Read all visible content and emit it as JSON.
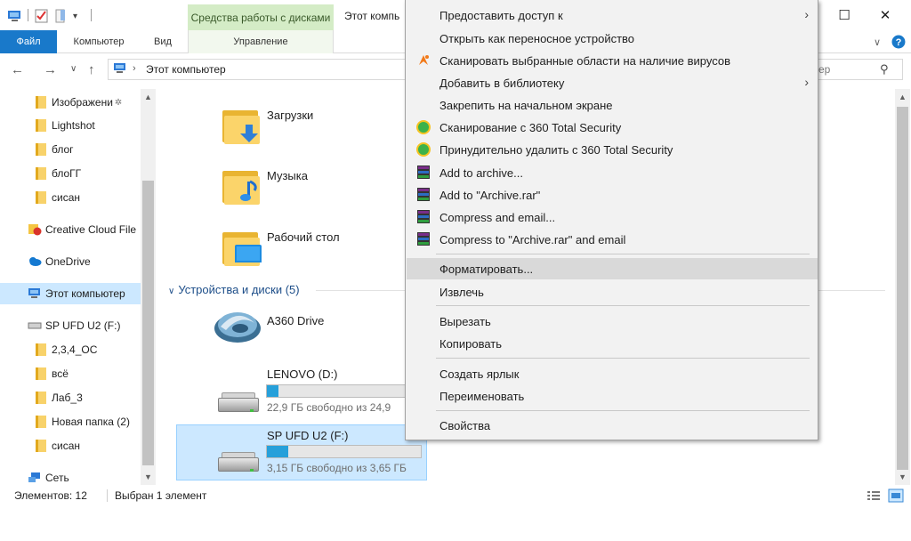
{
  "window": {
    "title": "Этот компь",
    "tools_tab": "Средства работы с дисками",
    "minimize": "—",
    "maximize": "☐",
    "close": "✕"
  },
  "ribbon": {
    "tabs": [
      "Файл",
      "Компьютер",
      "Вид",
      "Управление"
    ]
  },
  "address": {
    "path": "Этот компьютер",
    "search_placeholder": "ер"
  },
  "nav": {
    "items": [
      {
        "label": "Изображени",
        "pinned": true
      },
      {
        "label": "Lightshot"
      },
      {
        "label": "блог"
      },
      {
        "label": "блоГГ"
      },
      {
        "label": "сисан"
      },
      {
        "label": "Creative Cloud File"
      },
      {
        "label": "OneDrive"
      },
      {
        "label": "Этот компьютер",
        "selected": true
      },
      {
        "label": "SP UFD U2 (F:)"
      },
      {
        "label": "2,3,4_OC"
      },
      {
        "label": "всё"
      },
      {
        "label": "Лаб_3"
      },
      {
        "label": "Новая папка (2)"
      },
      {
        "label": "сисан"
      },
      {
        "label": "Сеть"
      }
    ]
  },
  "content": {
    "folders": [
      {
        "label": "Загрузки",
        "icon": "download-arrow"
      },
      {
        "label": "Музыка",
        "icon": "music-note"
      },
      {
        "label": "Рабочий стол",
        "icon": "desktop"
      }
    ],
    "group_header": "Устройства и диски (5)",
    "a360": {
      "label": "A360 Drive"
    },
    "drives": [
      {
        "label": "LENOVO (D:)",
        "free": "22,9 ГБ свободно из 24,9",
        "used_fraction": 0.08
      },
      {
        "label": "SP UFD U2 (F:)",
        "free": "3,15 ГБ свободно из 3,65 ГБ",
        "used_fraction": 0.14,
        "selected": true
      }
    ]
  },
  "status": {
    "count": "Элементов: 12",
    "selected": "Выбран 1 элемент"
  },
  "context_menu": {
    "items": [
      {
        "label": "Предоставить доступ к",
        "submenu": true
      },
      {
        "label": "Открыть как переносное устройство"
      },
      {
        "label": "Сканировать выбранные области на наличие вирусов",
        "icon": "avast"
      },
      {
        "label": "Добавить в библиотеку",
        "submenu": true
      },
      {
        "label": "Закрепить на начальном экране"
      },
      {
        "label": "Сканирование с 360 Total Security",
        "icon": "360"
      },
      {
        "label": "Принудительно удалить с  360 Total Security",
        "icon": "360"
      },
      {
        "label": "Add to archive...",
        "icon": "winrar"
      },
      {
        "label": "Add to \"Archive.rar\"",
        "icon": "winrar"
      },
      {
        "label": "Compress and email...",
        "icon": "winrar"
      },
      {
        "label": "Compress to \"Archive.rar\" and email",
        "icon": "winrar"
      },
      {
        "label": "Форматировать...",
        "hover": true
      },
      {
        "label": "Извлечь"
      },
      {
        "label": "Вырезать"
      },
      {
        "label": "Копировать"
      },
      {
        "label": "Создать ярлык"
      },
      {
        "label": "Переименовать"
      },
      {
        "label": "Свойства"
      }
    ]
  },
  "colors": {
    "accent": "#1979ca",
    "tools_tab": "#d4ecc6",
    "selection": "#cce8ff",
    "progress": "#26a0da"
  }
}
